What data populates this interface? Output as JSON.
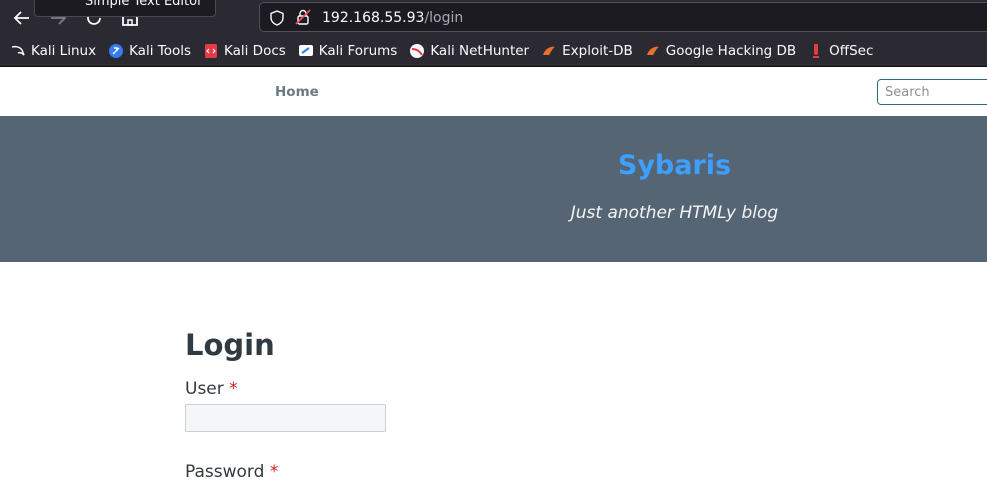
{
  "browser": {
    "tooltip": "Simple Text Editor",
    "url_host": "192.168.55.93",
    "url_path": "/login",
    "bookmarks": [
      {
        "label": "Kali Linux",
        "icon": "kali-dragon-icon",
        "color": "#ffffff"
      },
      {
        "label": "Kali Tools",
        "icon": "kali-tools-icon",
        "color": "#367bf0"
      },
      {
        "label": "Kali Docs",
        "icon": "kali-docs-icon",
        "color": "#e43b44"
      },
      {
        "label": "Kali Forums",
        "icon": "kali-forums-icon",
        "color": "#ffffff"
      },
      {
        "label": "Kali NetHunter",
        "icon": "nethunter-icon",
        "color": "#e43b44"
      },
      {
        "label": "Exploit-DB",
        "icon": "exploit-db-icon",
        "color": "#e7702a"
      },
      {
        "label": "Google Hacking DB",
        "icon": "ghdb-icon",
        "color": "#e7702a"
      },
      {
        "label": "OffSec",
        "icon": "offsec-icon",
        "color": "#e43b44"
      }
    ]
  },
  "nav": {
    "home_label": "Home",
    "search_placeholder": "Search"
  },
  "hero": {
    "title": "Sybaris",
    "tagline": "Just another HTMLy blog"
  },
  "login": {
    "heading": "Login",
    "user_label": "User",
    "password_label": "Password",
    "required_mark": "*"
  },
  "colors": {
    "hero_bg": "#556573",
    "title": "#3e9fff",
    "required": "#cc1f1f"
  }
}
